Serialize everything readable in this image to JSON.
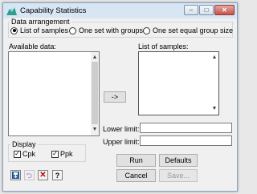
{
  "window": {
    "title": "Capability Statistics",
    "minimize_glyph": "–",
    "maximize_glyph": "□",
    "close_glyph": "✕",
    "app_icon": "chart-mountain-icon"
  },
  "data_arrangement": {
    "label": "Data arrangement",
    "options": [
      "List of samples",
      "One set with groups",
      "One set equal group size"
    ],
    "selected": "List of samples"
  },
  "available_data": {
    "label": "Available data:"
  },
  "list_of_samples": {
    "label": "List of samples:"
  },
  "transfer_button": {
    "label": "->"
  },
  "lower_limit": {
    "label": "Lower limit:",
    "value": ""
  },
  "upper_limit": {
    "label": "Upper limit:",
    "value": ""
  },
  "display": {
    "label": "Display",
    "items": [
      {
        "label": "Cpk",
        "checked": true
      },
      {
        "label": "Ppk",
        "checked": true
      }
    ]
  },
  "buttons": {
    "run": "Run",
    "defaults": "Defaults",
    "cancel": "Cancel",
    "save": "Save..."
  },
  "toolbar_icons": [
    "save-to-file-icon",
    "undo-icon",
    "clear-icon",
    "help-icon"
  ],
  "help_glyph": "?",
  "clear_glyph": "✕",
  "check_glyph": "✓",
  "colors": {
    "titlebar": "#d8e6f4",
    "dialog_bg": "#f0f0f0",
    "close_button": "#c75050",
    "clear_icon": "#c00000"
  }
}
